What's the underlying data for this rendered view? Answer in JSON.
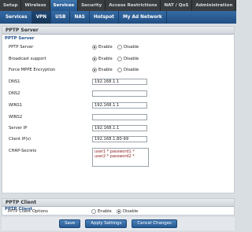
{
  "topnav": [
    "Setup",
    "Wireless",
    "Services",
    "Security",
    "Access Restrictions",
    "NAT / QoS",
    "Administration"
  ],
  "subnav": [
    "Services",
    "VPN",
    "USB",
    "NAS",
    "Hotspot",
    "My Ad Network"
  ],
  "pptp_server": {
    "header": "PPTP Server",
    "legend": "PPTP Server",
    "rows": {
      "pptp_server": {
        "label": "PPTP Server",
        "enable": "Enable",
        "disable": "Disable"
      },
      "broadcast": {
        "label": "Broadcast support",
        "enable": "Enable",
        "disable": "Disable"
      },
      "mppe": {
        "label": "Force MPPE Encryption",
        "enable": "Enable",
        "disable": "Disable"
      },
      "dns1": {
        "label": "DNS1",
        "value": "192.168.1.1"
      },
      "dns2": {
        "label": "DNS2",
        "value": ""
      },
      "wins1": {
        "label": "WINS1",
        "value": "192.168.1.1"
      },
      "wins2": {
        "label": "WINS2",
        "value": ""
      },
      "server_ip": {
        "label": "Server IP",
        "value": "192.168.1.1"
      },
      "client_ips": {
        "label": "Client IP(s)",
        "value": "192.168.1.80-99"
      },
      "chap": {
        "label": "CHAP-Secrets",
        "value": "user1 * password1 *\nuser2 * password2 *"
      }
    }
  },
  "pptp_client": {
    "header": "PPTP Client",
    "legend": "PPTP Client",
    "options": {
      "label": "PPTP Client Options",
      "enable": "Enable",
      "disable": "Disable"
    }
  },
  "buttons": {
    "save": "Save",
    "apply": "Apply Settings",
    "cancel": "Cancel Changes"
  }
}
